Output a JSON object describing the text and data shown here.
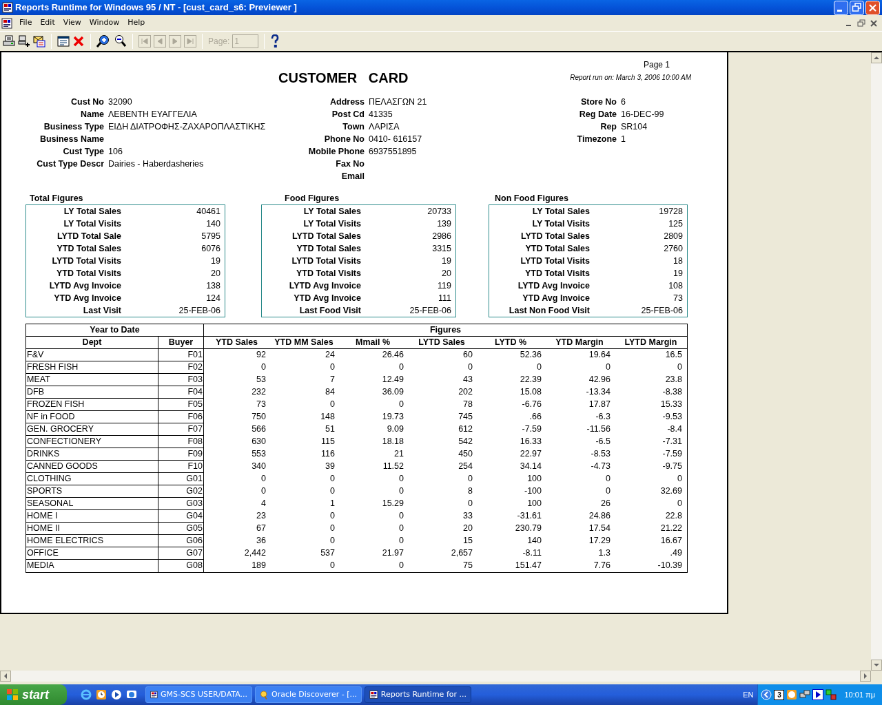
{
  "window": {
    "title": "Reports Runtime for Windows 95 / NT - [cust_card_s6: Previewer ]"
  },
  "menu": [
    "File",
    "Edit",
    "View",
    "Window",
    "Help"
  ],
  "toolbar": {
    "nav_buttons": [
      {
        "disabled": true
      },
      {
        "disabled": true
      },
      {
        "disabled": true
      },
      {
        "disabled": true
      }
    ],
    "page_field": {
      "label": "Page:",
      "value": "1",
      "disabled": true
    }
  },
  "report": {
    "title": "CUSTOMER   CARD",
    "page": "Page 1",
    "run_on": "Report run on: March 3, 2006 10:00 AM",
    "info_columns": [
      [
        {
          "label": "Cust No",
          "value": "32090"
        },
        {
          "label": "Name",
          "value": "ΛΕΒΕΝΤΗ ΕΥΑΓΓΕΛΙΑ"
        },
        {
          "label": "Business Type",
          "value": "ΕΙΔΗ ΔΙΑΤΡΟΦΗΣ-ΖΑΧΑΡΟΠΛΑΣΤΙΚΗΣ"
        },
        {
          "label": "Business Name"
        },
        {
          "label": "Cust Type",
          "value": "106"
        },
        {
          "label": "Cust Type Descr",
          "value": "Dairies - Haberdasheries"
        }
      ],
      [
        {
          "label": "Address",
          "value": "ΠΕΛΑΣΓΩΝ  21"
        },
        {
          "label": "Post Cd",
          "value": "41335"
        },
        {
          "label": "Town",
          "value": "ΛΑΡΙΣΑ"
        },
        {
          "label": "Phone No",
          "value": "0410- 616157"
        },
        {
          "label": "Mobile Phone",
          "value": "6937551895"
        },
        {
          "label": "Fax No"
        },
        {
          "label": "Email"
        }
      ],
      [
        {
          "label": "Store No",
          "value": "6"
        },
        {
          "label": "Reg Date",
          "value": "16-DEC-99"
        },
        {
          "label": "Rep",
          "value": "SR104"
        },
        {
          "label": "Timezone",
          "value": "1"
        }
      ]
    ],
    "figure_boxes": [
      {
        "title": "Total Figures",
        "rows": [
          [
            "LY Total Sales",
            "40461"
          ],
          [
            "LY Total Visits",
            "140"
          ],
          [
            "LYTD Total Sale",
            "5795"
          ],
          [
            "YTD Total Sales",
            "6076"
          ],
          [
            "LYTD Total Visits",
            "19"
          ],
          [
            "YTD Total Visits",
            "20"
          ],
          [
            "LYTD Avg Invoice",
            "138"
          ],
          [
            "YTD Avg Invoice",
            "124"
          ],
          [
            "Last Visit",
            "25-FEB-06"
          ]
        ]
      },
      {
        "title": "Food Figures",
        "rows": [
          [
            "LY Total Sales",
            "20733"
          ],
          [
            "LY Total Visits",
            "139"
          ],
          [
            "LYTD Total Sales",
            "2986"
          ],
          [
            "YTD Total Sales",
            "3315"
          ],
          [
            "LYTD Total Visits",
            "19"
          ],
          [
            "YTD Total Visits",
            "20"
          ],
          [
            "LYTD Avg Invoice",
            "119"
          ],
          [
            "YTD Avg Invoice",
            "111"
          ],
          [
            "Last Food Visit",
            "25-FEB-06"
          ]
        ]
      },
      {
        "title": "Non Food Figures",
        "rows": [
          [
            "LY Total Sales",
            "19728"
          ],
          [
            "LY Total Visits",
            "125"
          ],
          [
            "LYTD Total Sales",
            "2809"
          ],
          [
            "YTD Total Sales",
            "2760"
          ],
          [
            "LYTD Total Visits",
            "18"
          ],
          [
            "YTD Total Visits",
            "19"
          ],
          [
            "LYTD Avg Invoice",
            "108"
          ],
          [
            "YTD Avg Invoice",
            "73"
          ],
          [
            "Last Non Food Visit",
            "25-FEB-06"
          ]
        ]
      }
    ],
    "table": {
      "group_headers": [
        "Year to Date",
        "Figures"
      ],
      "columns": [
        "Dept",
        "Buyer",
        "YTD Sales",
        "YTD MM Sales",
        "Mmail %",
        "LYTD Sales",
        "LYTD %",
        "YTD Margin",
        "LYTD Margin"
      ],
      "rows": [
        [
          "F&V",
          "F01",
          "92",
          "24",
          "26.46",
          "60",
          "52.36",
          "19.64",
          "16.5"
        ],
        [
          "FRESH FISH",
          "F02",
          "0",
          "0",
          "0",
          "0",
          "0",
          "0",
          "0"
        ],
        [
          "MEAT",
          "F03",
          "53",
          "7",
          "12.49",
          "43",
          "22.39",
          "42.96",
          "23.8"
        ],
        [
          "DFB",
          "F04",
          "232",
          "84",
          "36.09",
          "202",
          "15.08",
          "-13.34",
          "-8.38"
        ],
        [
          "FROZEN FISH",
          "F05",
          "73",
          "0",
          "0",
          "78",
          "-6.76",
          "17.87",
          "15.33"
        ],
        [
          "NF in FOOD",
          "F06",
          "750",
          "148",
          "19.73",
          "745",
          ".66",
          "-6.3",
          "-9.53"
        ],
        [
          "GEN. GROCERY",
          "F07",
          "566",
          "51",
          "9.09",
          "612",
          "-7.59",
          "-11.56",
          "-8.4"
        ],
        [
          "CONFECTIONERY",
          "F08",
          "630",
          "115",
          "18.18",
          "542",
          "16.33",
          "-6.5",
          "-7.31"
        ],
        [
          "DRINKS",
          "F09",
          "553",
          "116",
          "21",
          "450",
          "22.97",
          "-8.53",
          "-7.59"
        ],
        [
          "CANNED GOODS",
          "F10",
          "340",
          "39",
          "11.52",
          "254",
          "34.14",
          "-4.73",
          "-9.75"
        ],
        [
          "CLOTHING",
          "G01",
          "0",
          "0",
          "0",
          "0",
          "100",
          "0",
          "0"
        ],
        [
          "SPORTS",
          "G02",
          "0",
          "0",
          "0",
          "8",
          "-100",
          "0",
          "32.69"
        ],
        [
          "SEASONAL",
          "G03",
          "4",
          "1",
          "15.29",
          "0",
          "100",
          "26",
          "0"
        ],
        [
          "HOME I",
          "G04",
          "23",
          "0",
          "0",
          "33",
          "-31.61",
          "24.86",
          "22.8"
        ],
        [
          "HOME II",
          "G05",
          "67",
          "0",
          "0",
          "20",
          "230.79",
          "17.54",
          "21.22"
        ],
        [
          "HOME ELECTRICS",
          "G06",
          "36",
          "0",
          "0",
          "15",
          "140",
          "17.29",
          "16.67"
        ],
        [
          "OFFICE",
          "G07",
          "2,442",
          "537",
          "21.97",
          "2,657",
          "-8.11",
          "1.3",
          ".49"
        ],
        [
          "MEDIA",
          "G08",
          "189",
          "0",
          "0",
          "75",
          "151.47",
          "7.76",
          "-10.39"
        ]
      ]
    }
  },
  "taskbar": {
    "start": "start",
    "tasks": [
      {
        "label": "GMS-SCS USER/DATA...",
        "selected": false
      },
      {
        "label": "Oracle Discoverer - [...",
        "selected": false
      },
      {
        "label": "Reports Runtime for ...",
        "selected": true
      }
    ],
    "tray": {
      "language": "EN",
      "badge": "3",
      "clock": "10:01 πμ"
    }
  }
}
